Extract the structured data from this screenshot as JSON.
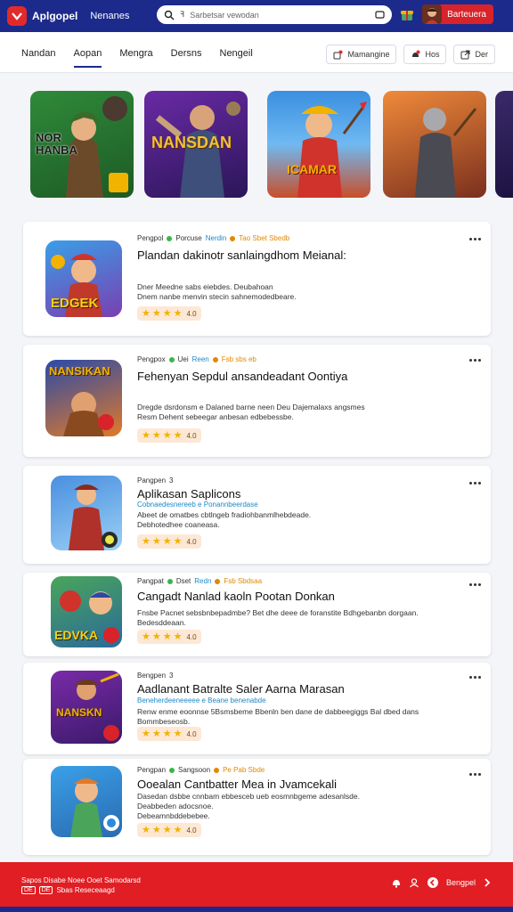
{
  "header": {
    "app_name": "Aplgopel",
    "nav_link": "Nenanes",
    "search_placeholder": "Sarbetsar vewodan",
    "user_label": "Barteuera"
  },
  "tabs": {
    "items": [
      "Nandan",
      "Aopan",
      "Mengra",
      "Dersns",
      "Nengeil"
    ],
    "active": "Aopan",
    "pills": [
      "Mamangine",
      "Hos",
      "Der"
    ]
  },
  "banners": [
    {
      "caption": "NOR HANBA"
    },
    {
      "caption": "NANSDAN"
    },
    {
      "caption": "ICAMAR"
    },
    {
      "caption": ""
    }
  ],
  "cards": [
    {
      "meta": [
        "Pengpol",
        "Porcuse",
        "Nerdin",
        "Tao Sbet Sbedb"
      ],
      "title": "Plandan dakinotr sanlaingdhom Meianal:",
      "desc": [
        "Dner Meedne sabs eiebdes. Deubahoan",
        "Dnem nanbe menvin stecin sahnemodedbeare."
      ],
      "icon_text": "EDGEK",
      "rating": "4.0"
    },
    {
      "meta": [
        "Pengpox",
        "Uei",
        "Reen",
        "Fsb sbs eb"
      ],
      "title": "Fehenyan Sepdul ansandeadant Oontiya",
      "desc": [
        "Dregde dsrdonsm e Dalaned barne neen Deu Dajemalaxs angsmes",
        "Resm Dehent sebeegar anbesan edbebessbe."
      ],
      "icon_text": "NANSIKAN",
      "rating": "4.0"
    },
    {
      "meta": [
        "Pangpen",
        "3"
      ],
      "title": "Aplikasan Saplicons",
      "sub": "Cobnaedesnereeb e Ponannbeerdase",
      "desc": [
        "Abeet de omatbes cbtlngeb fradiohbanmlhebdeade.",
        "Debhotedhee coaneasa."
      ],
      "rating": "4.0"
    },
    {
      "meta": [
        "Pangpat",
        "Dset",
        "Redn",
        "Fsb Sbdsaa"
      ],
      "title": "Cangadt Nanlad kaoln Pootan Donkan",
      "desc": [
        "Fnsbe Pacnet sebsbnbepadmbe? Bet dhe deee de foranstite Bdhgebanbn dorgaan.",
        "Bedesddeaan."
      ],
      "icon_text": "EDVKA",
      "rating": "4.0"
    },
    {
      "meta": [
        "Bengpen",
        "3"
      ],
      "title": "Aadlanant Batralte Saler Aarna Marasan",
      "sub": "Beneherdeeneeeee e Beane benenabde",
      "desc": [
        "Renw enme eoonnse 5Bsmsbeme Bbenln ben dane de dabbeegiggs Bal dbed dans",
        "Bommbeseosb."
      ],
      "icon_text": "NANSKN",
      "rating": "4.0"
    },
    {
      "meta": [
        "Pengpan",
        "Sangsoon",
        "Pe Pab Sbde"
      ],
      "title": "Ooealan Cantbatter Mea in Jvamcekali",
      "desc": [
        "Dasedan dsbbe cnnbam ebbesceb ueb eosmnbgeme adesanlsde.",
        "Deabbeden adocsnoe.",
        "Debeamnbddebebee."
      ],
      "rating": "4.0"
    }
  ],
  "footer": {
    "lines": [
      "Sapos Disabe Noee Ooet Samodarsd",
      "Sbas Reseceaagd"
    ],
    "badges": [
      "DE",
      "DE"
    ],
    "lang_label": "Bengpel"
  },
  "colors": {
    "header_bg": "#1c2a8c",
    "footer_bg": "#e01e24",
    "accent_red": "#d8232a",
    "star": "#f2b200"
  }
}
